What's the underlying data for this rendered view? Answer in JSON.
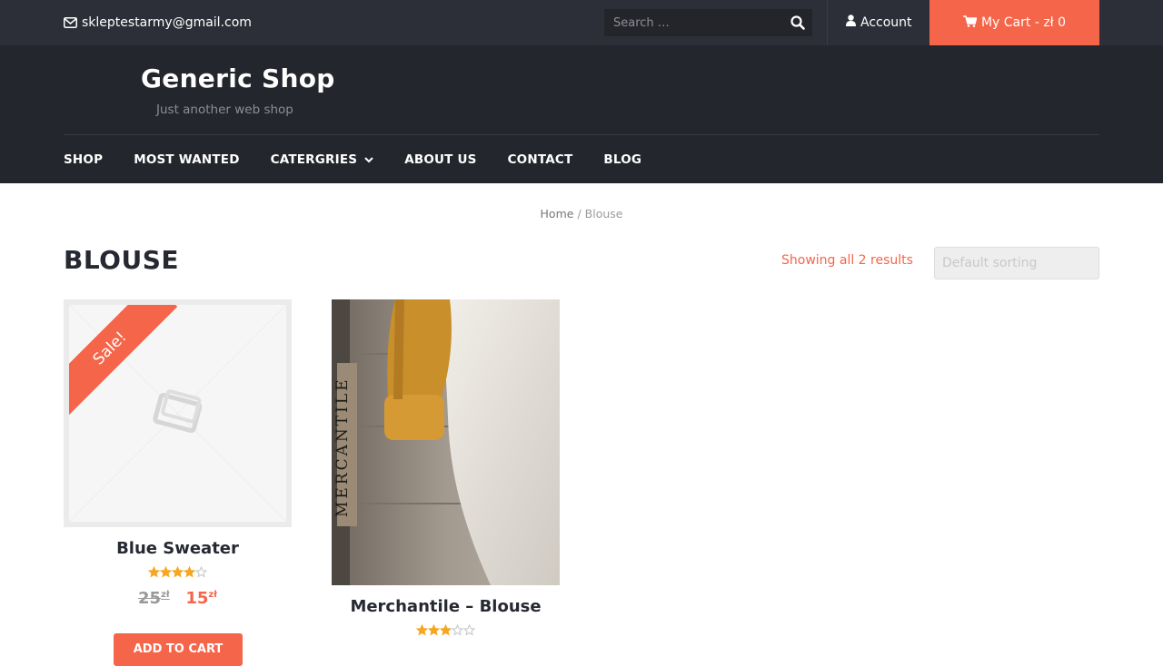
{
  "topbar": {
    "email": "skleptestarmy@gmail.com",
    "search_placeholder": "Search …",
    "account_label": "Account",
    "cart_label": "My Cart - zł 0"
  },
  "header": {
    "site_title": "Generic Shop",
    "tagline": "Just another web shop"
  },
  "nav": {
    "items": [
      {
        "label": "SHOP"
      },
      {
        "label": "MOST WANTED"
      },
      {
        "label": "CATERGRIES"
      },
      {
        "label": "ABOUT US"
      },
      {
        "label": "CONTACT"
      },
      {
        "label": "BLOG"
      }
    ]
  },
  "breadcrumb": {
    "home": "Home",
    "separator": "/",
    "current": "Blouse"
  },
  "page": {
    "title": "BLOUSE",
    "results": "Showing all 2 results",
    "sorting": "Default sorting"
  },
  "products": [
    {
      "name": "Blue Sweater",
      "badge": "Sale!",
      "rating": 4,
      "rating_max": 5,
      "old_price": "25",
      "new_price": "15",
      "currency": "zł",
      "button": "ADD TO CART"
    },
    {
      "name": "Merchantile – Blouse",
      "rating": 3,
      "rating_max": 5,
      "image_text": "MERCANTILE"
    }
  ],
  "colors": {
    "accent": "#f5654a",
    "topbar": "#2d2f38",
    "header": "#24262d",
    "star": "#f5a623"
  }
}
